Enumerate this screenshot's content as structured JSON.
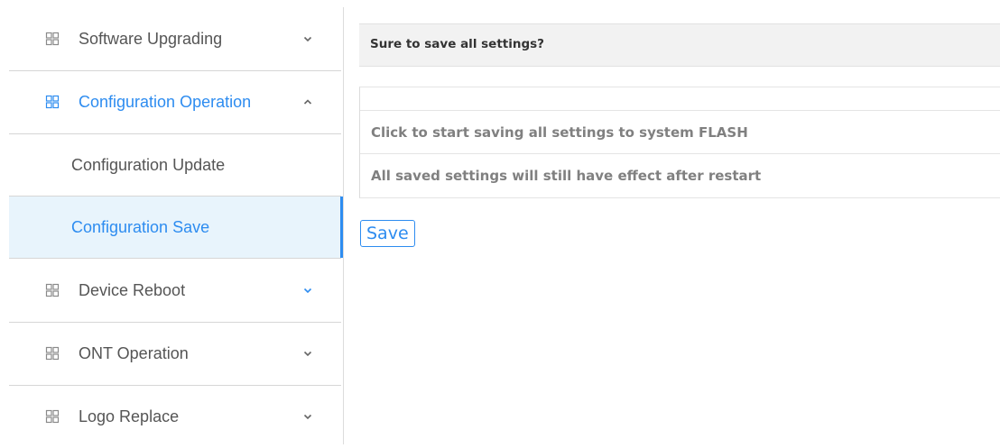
{
  "sidebar": {
    "groups": [
      {
        "label": "Software Upgrading",
        "icon": "grid-icon",
        "chevron": "chevron-down-icon"
      },
      {
        "label": "Configuration Operation",
        "icon": "grid-icon",
        "chevron": "chevron-up-icon"
      },
      {
        "label": "Device Reboot",
        "icon": "grid-icon",
        "chevron": "chevron-down-icon"
      },
      {
        "label": "ONT Operation",
        "icon": "grid-icon",
        "chevron": "chevron-down-icon"
      },
      {
        "label": "Logo Replace",
        "icon": "grid-icon",
        "chevron": "chevron-down-icon"
      }
    ],
    "sub_items": [
      {
        "label": "Configuration Update"
      },
      {
        "label": "Configuration Save"
      }
    ],
    "accent_color": "#2d8cf0"
  },
  "main": {
    "header_title": "Sure to save all settings?",
    "info_rows": [
      "Click to start saving all settings to system FLASH",
      "All saved settings will still have effect after restart"
    ],
    "save_label": "Save"
  }
}
